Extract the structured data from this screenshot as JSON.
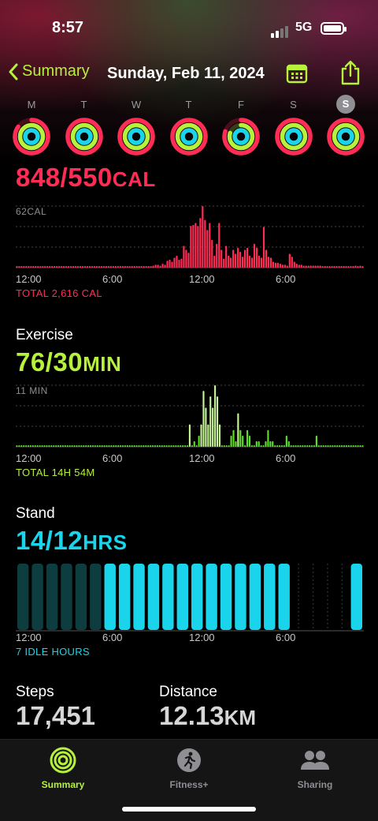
{
  "status_bar": {
    "time": "8:57",
    "network": "5G"
  },
  "nav": {
    "back_label": "Summary",
    "date": "Sunday, Feb 11, 2024"
  },
  "week": [
    {
      "day": "M",
      "today": false,
      "move": 0.85,
      "exercise": 1.0,
      "stand": 1.0
    },
    {
      "day": "T",
      "today": false,
      "move": 1.0,
      "exercise": 1.0,
      "stand": 1.0
    },
    {
      "day": "W",
      "today": false,
      "move": 1.0,
      "exercise": 1.0,
      "stand": 1.0
    },
    {
      "day": "T",
      "today": false,
      "move": 1.0,
      "exercise": 1.0,
      "stand": 1.0
    },
    {
      "day": "F",
      "today": false,
      "move": 0.8,
      "exercise": 0.8,
      "stand": 1.0
    },
    {
      "day": "S",
      "today": false,
      "move": 1.0,
      "exercise": 1.0,
      "stand": 1.0
    },
    {
      "day": "S",
      "today": true,
      "move": 1.0,
      "exercise": 1.0,
      "stand": 1.0
    }
  ],
  "move": {
    "value": "848/550",
    "unit": "CAL",
    "chart_max_label": "62CAL",
    "axis_labels": [
      "12:00",
      "6:00",
      "12:00",
      "6:00"
    ],
    "total": "TOTAL 2,616 CAL",
    "color": "#ff2d55"
  },
  "exercise": {
    "title": "Exercise",
    "value": "76/30",
    "unit": "MIN",
    "chart_max_label": "11 MIN",
    "axis_labels": [
      "12:00",
      "6:00",
      "12:00",
      "6:00"
    ],
    "total": "TOTAL 14H 54M",
    "color": "#b6f13b"
  },
  "stand": {
    "title": "Stand",
    "value": "14/12",
    "unit": "HRS",
    "axis_labels": [
      "12:00",
      "6:00",
      "12:00",
      "6:00"
    ],
    "total": "7 IDLE HOURS",
    "color": "#19d4ea"
  },
  "steps": {
    "label": "Steps",
    "value": "17,451"
  },
  "distance": {
    "label": "Distance",
    "value": "12.13",
    "unit": "KM"
  },
  "tabs": [
    {
      "label": "Summary",
      "icon": "activity-rings-icon",
      "active": true
    },
    {
      "label": "Fitness+",
      "icon": "runner-icon",
      "active": false
    },
    {
      "label": "Sharing",
      "icon": "people-icon",
      "active": false
    }
  ],
  "chart_data": [
    {
      "type": "bar",
      "title": "",
      "ylabel": "CAL",
      "ylim": [
        0,
        62
      ],
      "x_ticks": [
        "12:00",
        "6:00",
        "12:00",
        "6:00"
      ],
      "values": [
        1,
        1,
        1,
        1,
        1,
        1,
        1,
        1,
        1,
        1,
        1,
        1,
        1,
        1,
        1,
        1,
        1,
        1,
        1,
        1,
        1,
        1,
        1,
        1,
        1,
        1,
        1,
        1,
        1,
        1,
        1,
        1,
        1,
        1,
        1,
        1,
        1,
        1,
        1,
        1,
        1,
        1,
        1,
        1,
        1,
        1,
        1,
        1,
        1,
        1,
        1,
        1,
        1,
        1,
        1,
        1,
        1,
        1,
        2,
        3,
        3,
        2,
        4,
        3,
        7,
        8,
        6,
        10,
        12,
        8,
        9,
        22,
        18,
        15,
        42,
        43,
        45,
        42,
        50,
        62,
        48,
        38,
        45,
        28,
        12,
        24,
        45,
        18,
        9,
        22,
        12,
        10,
        18,
        14,
        20,
        16,
        11,
        18,
        20,
        12,
        10,
        24,
        20,
        12,
        10,
        41,
        18,
        11,
        10,
        6,
        5,
        5,
        4,
        3,
        3,
        2,
        14,
        11,
        6,
        4,
        3,
        3,
        2,
        2,
        2,
        2,
        2,
        2,
        2,
        2,
        1,
        1,
        1,
        1,
        1,
        1,
        1,
        1,
        1,
        1,
        1,
        1,
        1,
        1,
        2,
        1,
        2,
        1
      ]
    },
    {
      "type": "bar",
      "title": "",
      "ylabel": "MIN",
      "ylim": [
        0,
        11
      ],
      "x_ticks": [
        "12:00",
        "6:00",
        "12:00",
        "6:00"
      ],
      "values": [
        0,
        0,
        0,
        0,
        0,
        0,
        0,
        0,
        0,
        0,
        0,
        0,
        0,
        0,
        0,
        0,
        0,
        0,
        0,
        0,
        0,
        0,
        0,
        0,
        0,
        0,
        0,
        0,
        0,
        0,
        0,
        0,
        0,
        0,
        0,
        0,
        0,
        0,
        0,
        0,
        0,
        0,
        0,
        0,
        0,
        0,
        0,
        0,
        0,
        0,
        0,
        0,
        0,
        0,
        0,
        0,
        0,
        0,
        0,
        0,
        0,
        0,
        0,
        0,
        0,
        0,
        0,
        0,
        0,
        0,
        0,
        0,
        0,
        0,
        0,
        4,
        0,
        1,
        0,
        2,
        4,
        10,
        7,
        4,
        9,
        7,
        11,
        9,
        4,
        0,
        0,
        0,
        0,
        2,
        3,
        1,
        6,
        3,
        2,
        0,
        3,
        2,
        0,
        0,
        1,
        1,
        0,
        0,
        1,
        3,
        1,
        1,
        0,
        0,
        0,
        0,
        0,
        2,
        1,
        0,
        0,
        0,
        0,
        0,
        0,
        0,
        0,
        0,
        0,
        0,
        2,
        0,
        0,
        0,
        0,
        0,
        0,
        0,
        0,
        0,
        0,
        0,
        0,
        0,
        0,
        0,
        0,
        0,
        0,
        0,
        0
      ]
    },
    {
      "type": "bar",
      "title": "",
      "ylabel": "Stand hours",
      "categories": [
        "0",
        "1",
        "2",
        "3",
        "4",
        "5",
        "6",
        "7",
        "8",
        "9",
        "10",
        "11",
        "12",
        "13",
        "14",
        "15",
        "16",
        "17",
        "18",
        "19",
        "20",
        "21",
        "22",
        "23"
      ],
      "values": [
        0,
        0,
        0,
        0,
        0,
        0,
        1,
        1,
        1,
        1,
        1,
        1,
        1,
        1,
        1,
        1,
        1,
        1,
        1,
        0,
        0,
        0,
        0,
        1
      ]
    }
  ]
}
